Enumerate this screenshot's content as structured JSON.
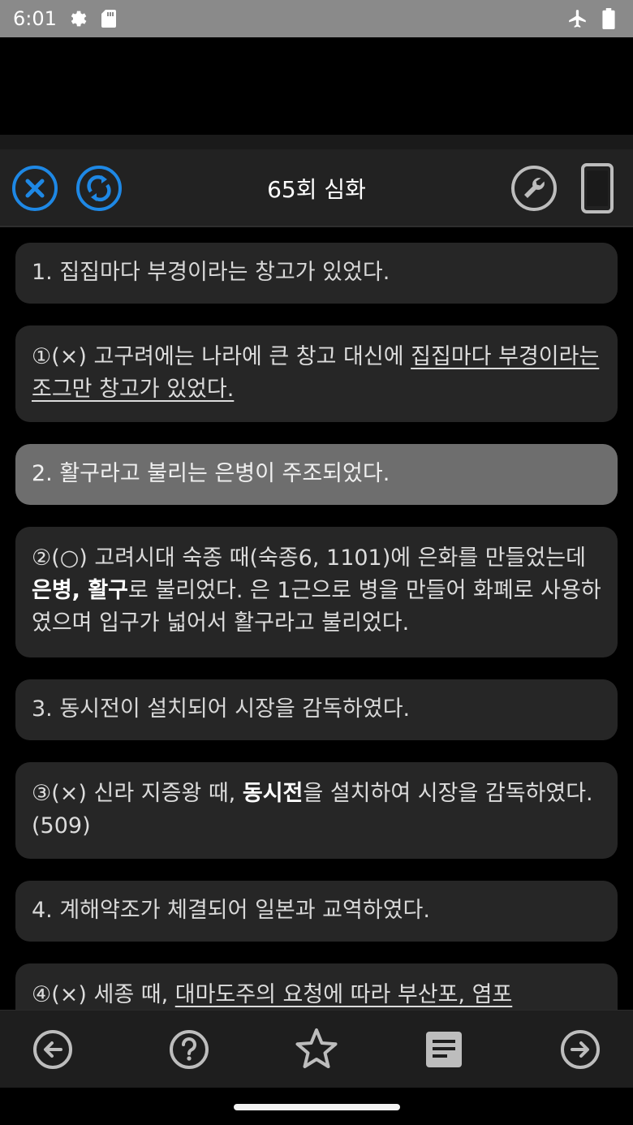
{
  "status_bar": {
    "time": "6:01",
    "icons": [
      "settings-gear-icon",
      "sd-card-icon",
      "airplane-mode-icon",
      "battery-icon"
    ]
  },
  "toolbar": {
    "title": "65회 심화",
    "left_icons": [
      "close-circle-icon",
      "sync-circle-icon"
    ],
    "right_icons": [
      "wrench-icon",
      "phone-icon"
    ],
    "accent": "#1e88e5"
  },
  "cards": {
    "q1": "1. 집집마다 부경이라는 창고가 있었다.",
    "a1": {
      "prefix": "①(×) 고구려에는 나라에 큰 창고 대신에 ",
      "underlined": "집집마다 부경이라는 조그만 창고가 있었다."
    },
    "q2": "2. 활구라고 불리는 은병이 주조되었다.",
    "a2": {
      "part1": "②(○) 고려시대 숙종 때(숙종6, 1101)에 은화를 만들었는데 ",
      "bold": "은병, 활구",
      "part2": "로 불리었다. 은 1근으로 병을 만들어 화폐로 사용하였으며 입구가 넓어서 활구라고 불리었다."
    },
    "q3": "3. 동시전이 설치되어 시장을 감독하였다.",
    "a3": {
      "part1": "③(×) 신라 지증왕 때, ",
      "bold": "동시전",
      "part2": "을 설치하여 시장을 감독하였다.(509)"
    },
    "q4": "4. 계해약조가 체결되어 일본과 교역하였다.",
    "a4": {
      "prefix": "④(×) 세종 때, ",
      "underlined": "대마도주의 요청에 따라 부산포, 염포"
    }
  },
  "colors": {
    "card_bg": "#262626",
    "selected_card_bg": "#6e6e6e",
    "toolbar_bg": "#222222",
    "nav_icon": "#bdbdbd"
  },
  "bottom_nav": {
    "icons": [
      "arrow-left-circle-icon",
      "help-circle-icon",
      "star-outline-icon",
      "note-icon",
      "arrow-right-circle-icon"
    ]
  }
}
